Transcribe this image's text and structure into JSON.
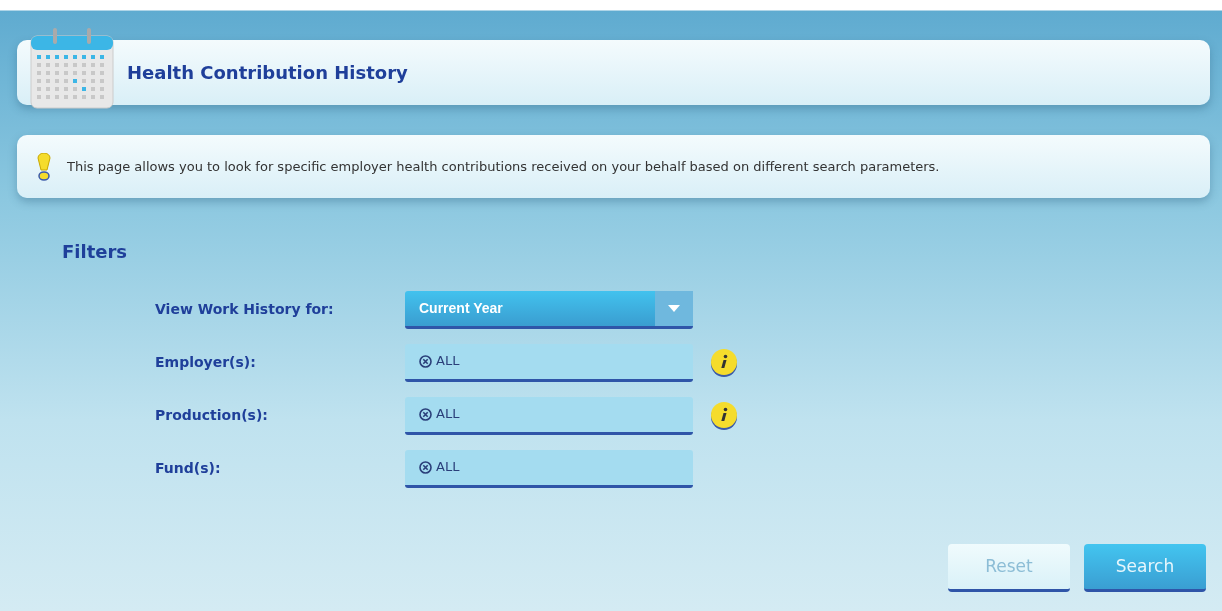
{
  "header": {
    "title": "Health Contribution History"
  },
  "notice": {
    "text": "This page allows you to look for specific employer health contributions received on your behalf based on different search parameters."
  },
  "filters": {
    "heading": "Filters",
    "rows": [
      {
        "label": "View Work History for:",
        "kind": "select",
        "value": "Current Year",
        "info": false
      },
      {
        "label": "Employer(s):",
        "kind": "tags",
        "tags": [
          "ALL"
        ],
        "info": true
      },
      {
        "label": "Production(s):",
        "kind": "tags",
        "tags": [
          "ALL"
        ],
        "info": true
      },
      {
        "label": "Fund(s):",
        "kind": "tags",
        "tags": [
          "ALL"
        ],
        "info": false
      }
    ]
  },
  "buttons": [
    {
      "label": "Reset",
      "kind": "secondary"
    },
    {
      "label": "Search",
      "kind": "primary"
    }
  ]
}
